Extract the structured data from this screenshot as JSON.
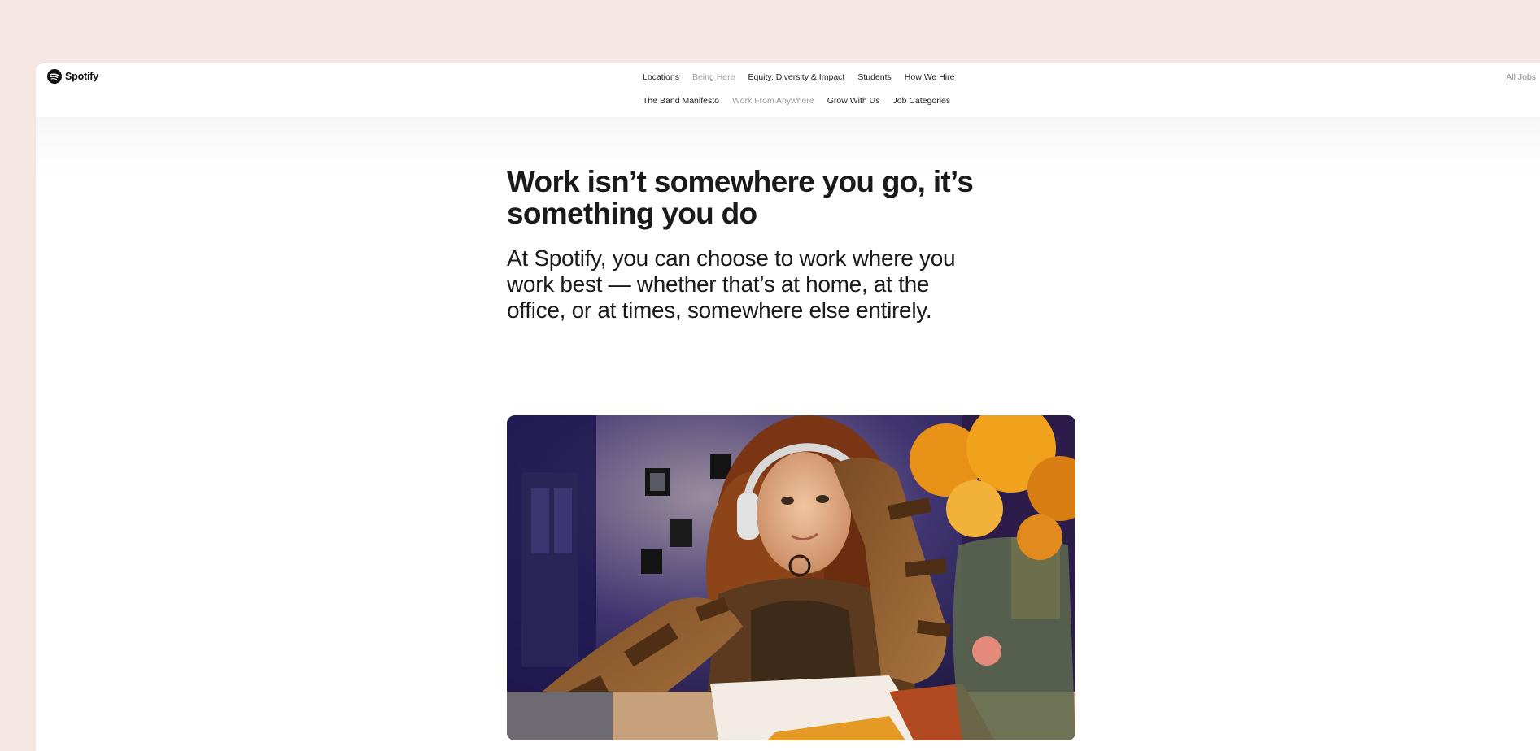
{
  "brand": {
    "logo_text": "Spotify",
    "logo_icon": "spotify-logo-icon",
    "accent": "#111111"
  },
  "nav": {
    "row1": [
      {
        "label": "Locations",
        "active": false
      },
      {
        "label": "Being Here",
        "active": true
      },
      {
        "label": "Equity, Diversity & Impact",
        "active": false
      },
      {
        "label": "Students",
        "active": false
      },
      {
        "label": "How We Hire",
        "active": false
      }
    ],
    "row2": [
      {
        "label": "The Band Manifesto",
        "active": false
      },
      {
        "label": "Work From Anywhere",
        "active": true
      },
      {
        "label": "Grow With Us",
        "active": false
      },
      {
        "label": "Job Categories",
        "active": false
      }
    ],
    "all_jobs": "All Jobs"
  },
  "main": {
    "headline": "Work isn’t somewhere you go, it’s something you do",
    "subhead": "At Spotify, you can choose to work where you work best — whether that’s at home, at the office, or at times, somewhere else entirely."
  },
  "colors": {
    "page_background": "#f5e6e3",
    "panel": "#ffffff",
    "text": "#1a1a1a",
    "muted_nav": "#9a9a9a"
  }
}
